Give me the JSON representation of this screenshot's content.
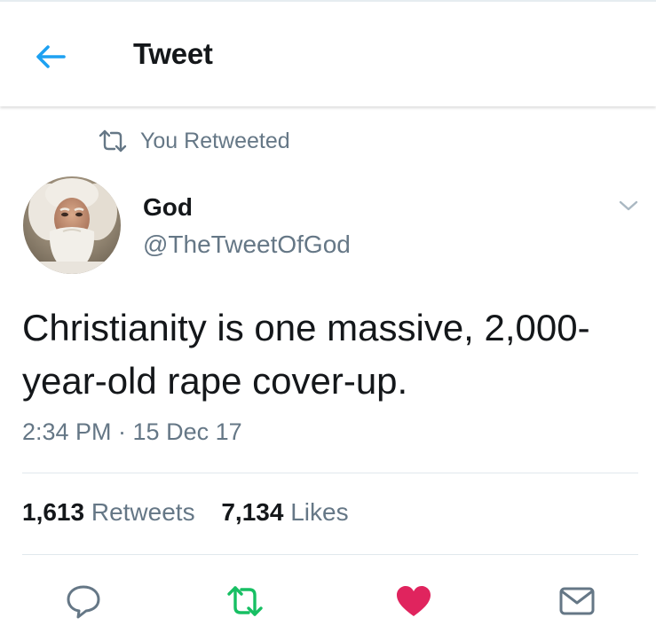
{
  "header": {
    "title": "Tweet"
  },
  "retweet_context": {
    "text": "You Retweeted"
  },
  "author": {
    "name": "God",
    "handle": "@TheTweetOfGod"
  },
  "tweet": {
    "text": "Christianity is one massive, 2,000-year-old rape cover-up.",
    "timestamp": "2:34 PM · 15 Dec 17"
  },
  "stats": {
    "retweets_count": "1,613",
    "retweets_label": "Retweets",
    "likes_count": "7,134",
    "likes_label": "Likes"
  },
  "colors": {
    "accent": "#1da1f2",
    "retweet_active": "#17bf63",
    "like_active": "#e0245e",
    "secondary_text": "#657786"
  },
  "icons": {
    "back": "arrow-left-icon",
    "retweet_context": "retweet-icon",
    "caret": "chevron-down-icon",
    "reply": "reply-icon",
    "retweet": "retweet-icon",
    "like": "heart-icon",
    "dm": "envelope-icon"
  }
}
